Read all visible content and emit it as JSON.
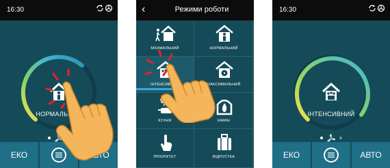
{
  "screen_left": {
    "time": "16:30",
    "mode_label": "НОРМАЛЬНИЙ",
    "buttons": {
      "eco": "ЕКО",
      "auto": "АВТО"
    },
    "pager": {
      "count": 3,
      "active": 0
    }
  },
  "screen_middle": {
    "title": "Режими роботи",
    "modes": [
      {
        "label": "МІНІМАЛЬНИЙ",
        "icon": "house-walk-icon"
      },
      {
        "label": "НОРМАЛЬНИЙ",
        "icon": "house-person-icon"
      },
      {
        "label": "ІНТЕНСИВНИЙ",
        "icon": "house-group-icon"
      },
      {
        "label": "МАКСИМАЛЬНИЙ",
        "icon": "house-fan-icon"
      },
      {
        "label": "КУХНЯ",
        "icon": "kitchen-icon"
      },
      {
        "label": "КАМІН",
        "icon": "fireplace-icon"
      },
      {
        "label": "ПРІОРИТЕТ",
        "icon": "touch-icon"
      },
      {
        "label": "ВІДПУСТКА",
        "icon": "suitcase-icon"
      }
    ]
  },
  "screen_right": {
    "time": "16:30",
    "mode_label": "ІНТЕНСИВНИЙ",
    "buttons": {
      "eco": "ЕКО",
      "auto": "АВТО"
    },
    "pager": {
      "count": 3,
      "active": 0
    }
  },
  "colors": {
    "background": "#154b59",
    "statusbar": "#0c0c0c",
    "button": "#1f6f87",
    "ring_gradient": [
      "#f0e24a",
      "#7fd36a",
      "#3fb5d6",
      "#4a7f8c"
    ],
    "hand": "#f5b55a",
    "tap_marks": "#e8202a"
  }
}
